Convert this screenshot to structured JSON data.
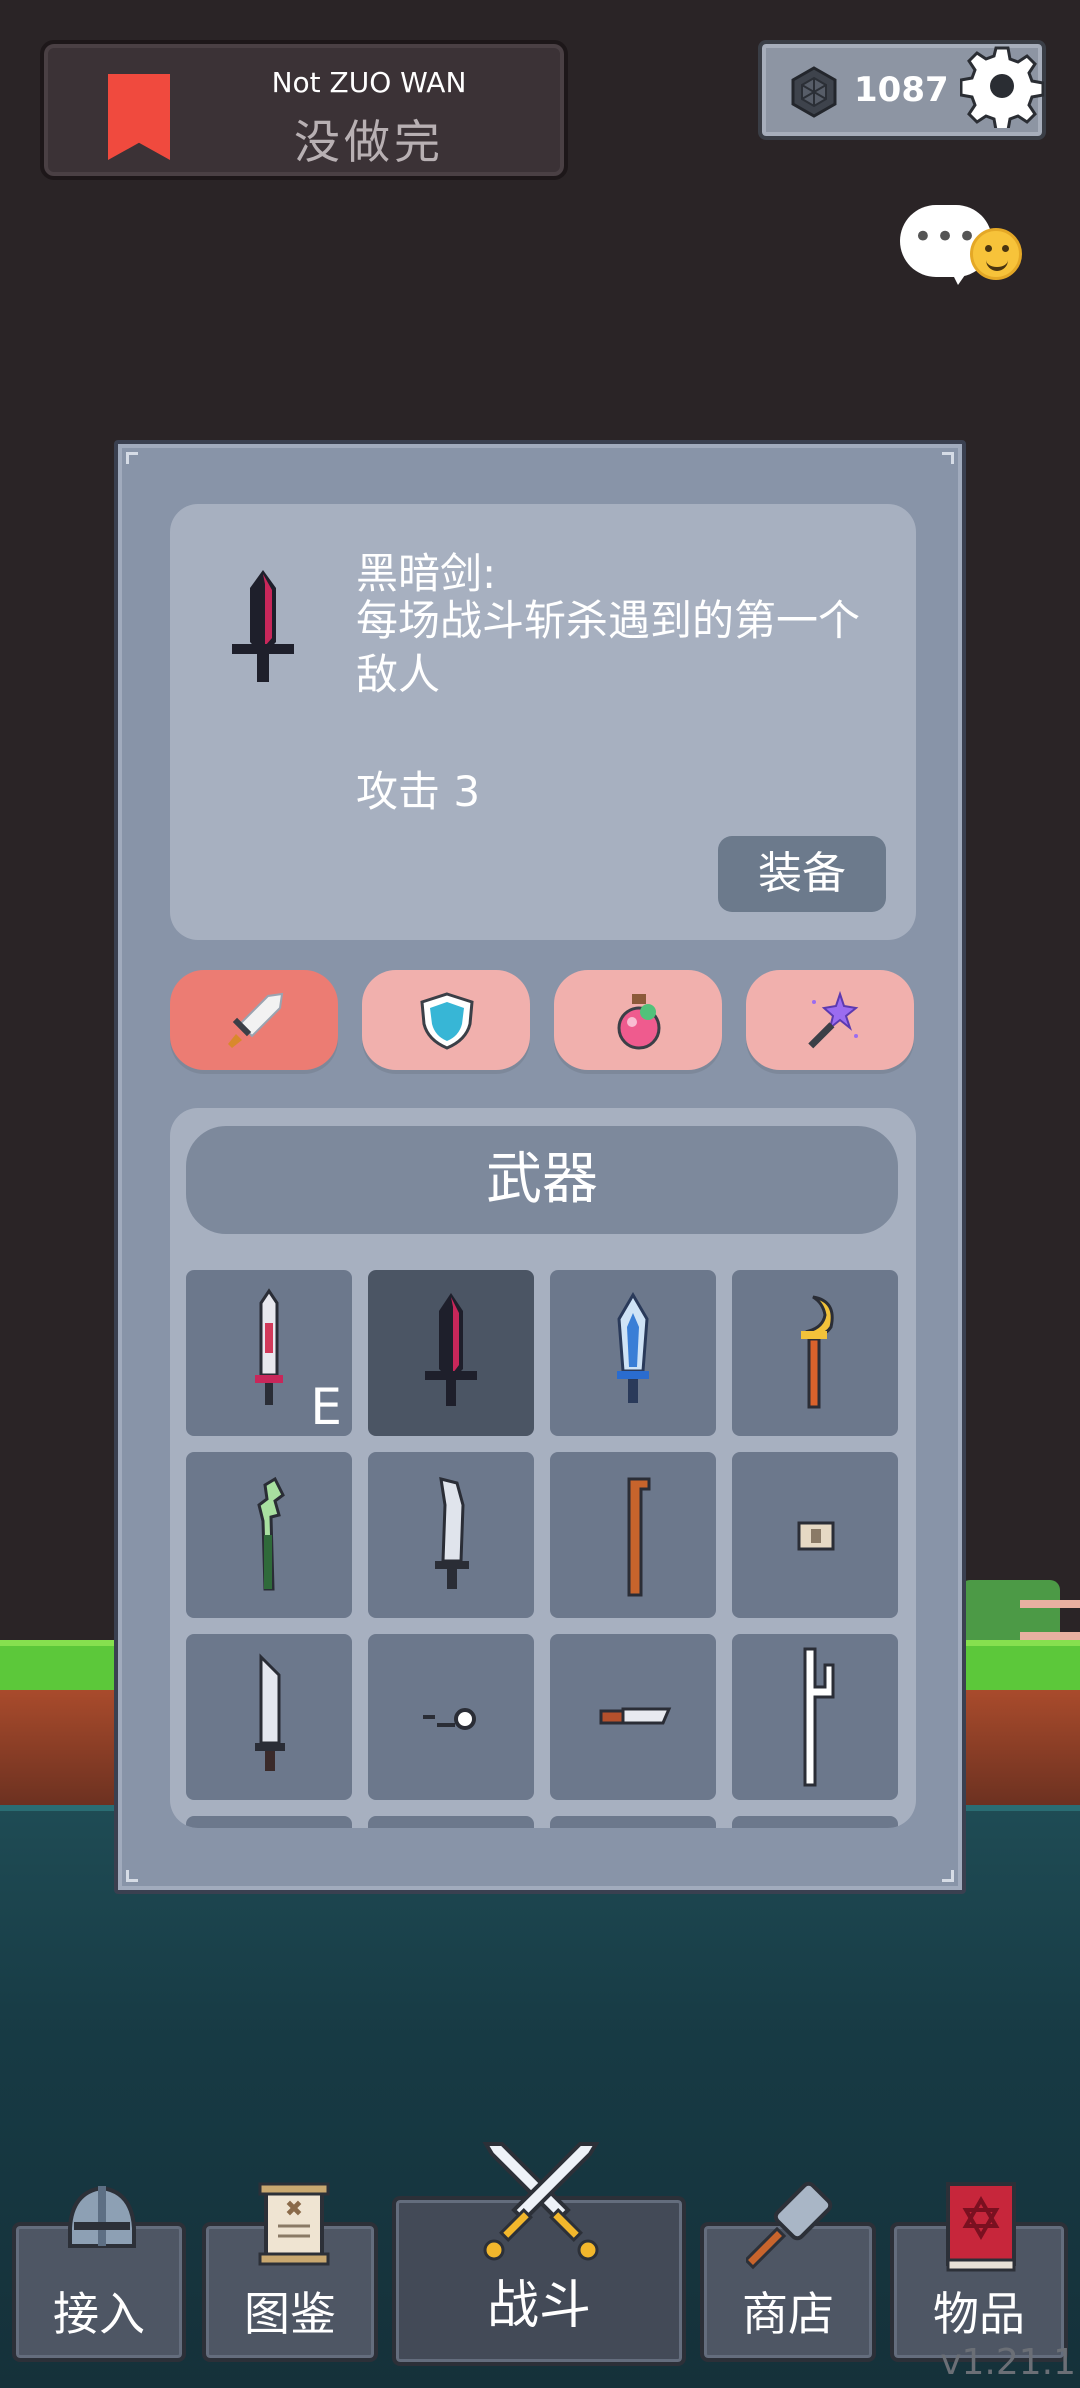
{
  "header": {
    "banner_title": "Not ZUO WAN",
    "banner_subtitle": "没做完",
    "gem_count": "1087"
  },
  "chat": {
    "dots": "•••"
  },
  "item_detail": {
    "name": "黑暗剑:",
    "description": "每场战斗斩杀遇到的第一个敌人",
    "stat": "攻击  3",
    "equip_label": "装备"
  },
  "category_tabs": [
    {
      "icon": "sword-icon",
      "active": true
    },
    {
      "icon": "shield-icon",
      "active": false
    },
    {
      "icon": "potion-icon",
      "active": false
    },
    {
      "icon": "magic-wand-icon",
      "active": false
    }
  ],
  "weapons": {
    "title": "武器",
    "equipped_marker": "E",
    "items": [
      {
        "icon": "bloody-sword-icon",
        "equipped": true,
        "selected": false
      },
      {
        "icon": "dark-sword-icon",
        "equipped": false,
        "selected": true
      },
      {
        "icon": "ice-sword-icon",
        "equipped": false,
        "selected": false
      },
      {
        "icon": "moon-staff-icon",
        "equipped": false,
        "selected": false
      },
      {
        "icon": "leek-icon",
        "equipped": false,
        "selected": false
      },
      {
        "icon": "curved-blade-icon",
        "equipped": false,
        "selected": false
      },
      {
        "icon": "wooden-cane-icon",
        "equipped": false,
        "selected": false
      },
      {
        "icon": "scroll-icon",
        "equipped": false,
        "selected": false
      },
      {
        "icon": "broad-sword-icon",
        "equipped": false,
        "selected": false
      },
      {
        "icon": "pellet-icon",
        "equipped": false,
        "selected": false
      },
      {
        "icon": "kitchen-knife-icon",
        "equipped": false,
        "selected": false
      },
      {
        "icon": "pitchfork-icon",
        "equipped": false,
        "selected": false
      }
    ]
  },
  "nav": {
    "items": [
      {
        "label": "接入",
        "icon": "knight-helmet-icon"
      },
      {
        "label": "图鉴",
        "icon": "scroll-icon"
      },
      {
        "label": "战斗",
        "icon": "crossed-swords-icon"
      },
      {
        "label": "商店",
        "icon": "hammer-icon"
      },
      {
        "label": "物品",
        "icon": "spellbook-icon"
      }
    ]
  },
  "version": "v1.21.1",
  "colors": {
    "background": "#2a2426",
    "panel": "#8894a8",
    "card": "#a7b0c0",
    "tab_active": "#ec7c73",
    "tab_inactive": "#f1b0ad",
    "bookmark": "#f04a3e"
  }
}
